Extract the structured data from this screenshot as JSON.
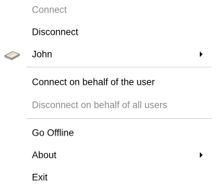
{
  "menu": {
    "items": [
      {
        "label": "Connect",
        "disabled": true
      },
      {
        "label": "Disconnect",
        "disabled": false
      },
      {
        "label": "John",
        "disabled": false,
        "submenu": true,
        "icon": "user-doc-icon"
      },
      {
        "label": "Connect on behalf of the user",
        "disabled": false
      },
      {
        "label": "Disconnect on behalf of all users",
        "disabled": true
      },
      {
        "label": "Go Offline",
        "disabled": false
      },
      {
        "label": "About",
        "disabled": false,
        "submenu": true
      },
      {
        "label": "Exit",
        "disabled": false
      }
    ],
    "colors": {
      "text": "#000000",
      "disabled_text": "#8a8a8a",
      "separator": "#d7d7d7",
      "background": "#ffffff"
    }
  }
}
